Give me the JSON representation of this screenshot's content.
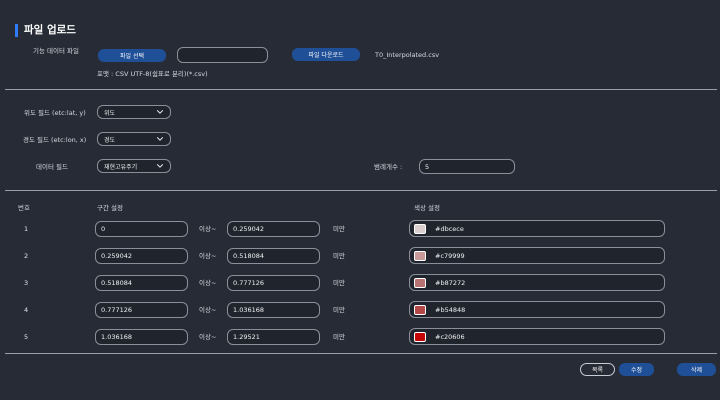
{
  "page": {
    "title": "파일 업로드"
  },
  "upload": {
    "label": "기능 데이터 파일",
    "select_button": "파일 선택",
    "file_input_value": "",
    "download_button": "파일 다운로드",
    "file_name": "T0_Interpolated.csv",
    "format_hint": "포맷 : CSV UTF-8(쉼표로 분리)(*.csv)"
  },
  "fields": {
    "lat_label": "위도 필드 (etc:lat, y)",
    "lat_value": "위도",
    "lon_label": "경도 필드 (etc:lon, x)",
    "lon_value": "경도",
    "data_label": "데이터 필드",
    "data_value": "재현고유주기",
    "class_label": "범례개수 :",
    "class_value": "5"
  },
  "table": {
    "headers": {
      "no": "번호",
      "range": "구간 설정",
      "color": "색상 설정"
    },
    "op_from": "이상~",
    "op_to": "미만",
    "rows": [
      {
        "no": "1",
        "from": "0",
        "to": "0.259042",
        "color": "#dbcece"
      },
      {
        "no": "2",
        "from": "0.259042",
        "to": "0.518084",
        "color": "#c79999"
      },
      {
        "no": "3",
        "from": "0.518084",
        "to": "0.777126",
        "color": "#b87272"
      },
      {
        "no": "4",
        "from": "0.777126",
        "to": "1.036168",
        "color": "#b54848"
      },
      {
        "no": "5",
        "from": "1.036168",
        "to": "1.29521",
        "color": "#c20606"
      }
    ]
  },
  "actions": {
    "list": "목록",
    "edit": "수정",
    "delete": "삭제"
  },
  "colors": {
    "accent": "#2f7cf6",
    "button_blue": "#1f4f97",
    "background": "#262b35"
  }
}
